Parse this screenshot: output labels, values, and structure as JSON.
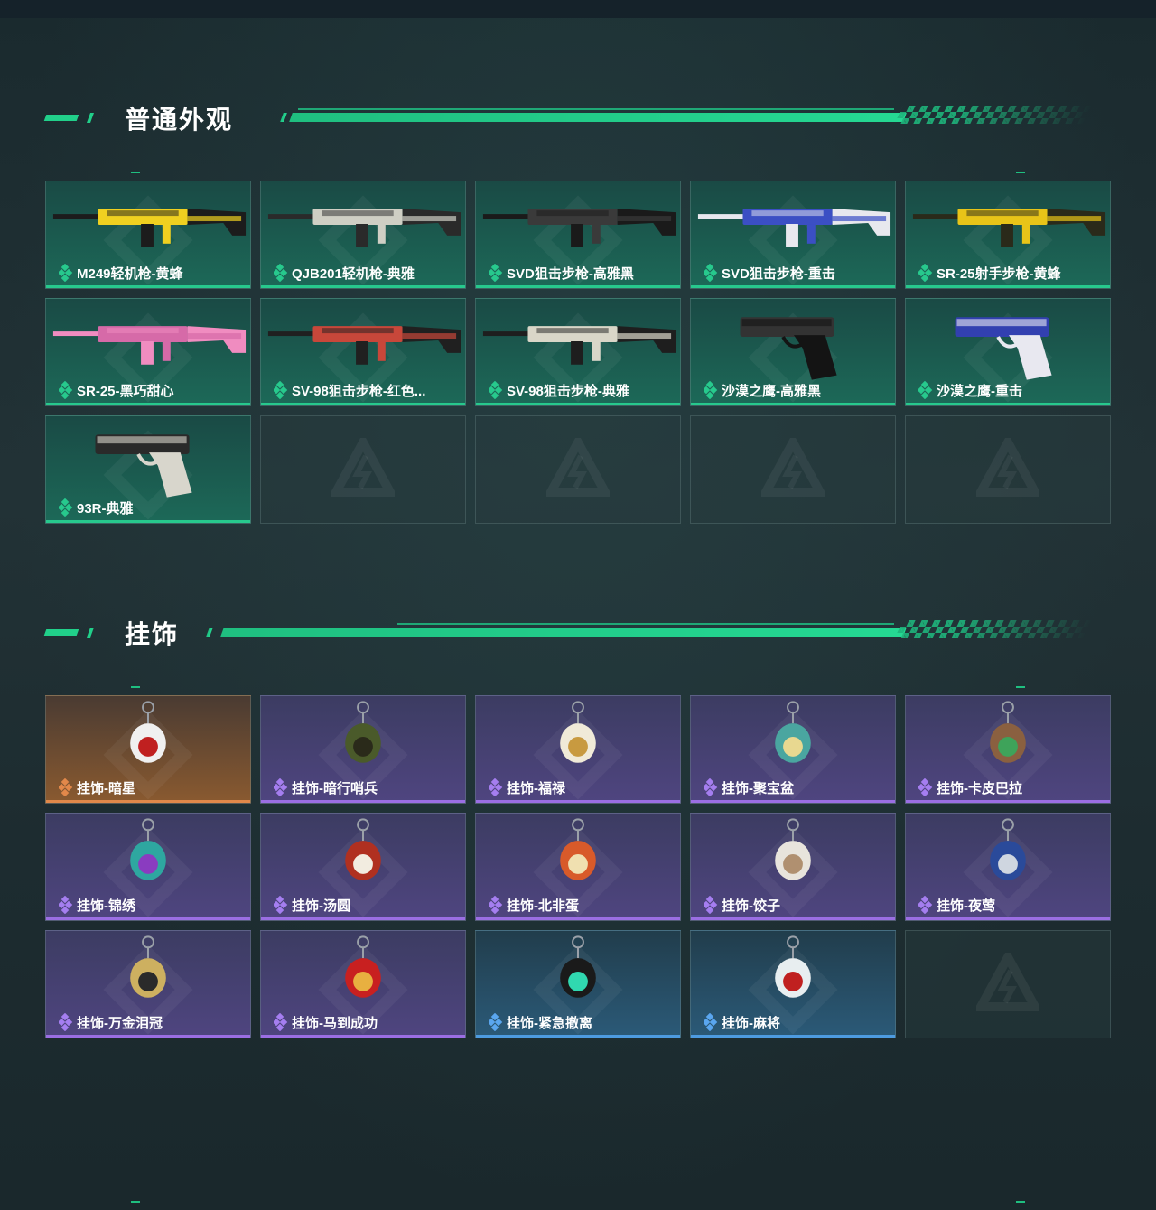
{
  "sections": [
    {
      "title": "普通外观",
      "items": [
        {
          "label": "M249轻机枪-黄蜂",
          "rarity": "green",
          "icon": "lmg-yellow-icon"
        },
        {
          "label": "QJB201轻机枪-典雅",
          "rarity": "green",
          "icon": "lmg-white-icon"
        },
        {
          "label": "SVD狙击步枪-高雅黑",
          "rarity": "green",
          "icon": "sniper-black-icon"
        },
        {
          "label": "SVD狙击步枪-重击",
          "rarity": "green",
          "icon": "sniper-blue-icon"
        },
        {
          "label": "SR-25射手步枪-黄蜂",
          "rarity": "green",
          "icon": "rifle-yellow-icon"
        },
        {
          "label": "SR-25-黑巧甜心",
          "rarity": "green",
          "icon": "rifle-pink-icon"
        },
        {
          "label": "SV-98狙击步枪-红色...",
          "rarity": "green",
          "icon": "sniper-red-icon"
        },
        {
          "label": "SV-98狙击步枪-典雅",
          "rarity": "green",
          "icon": "sniper-white-icon"
        },
        {
          "label": "沙漠之鹰-高雅黑",
          "rarity": "green",
          "icon": "pistol-black-icon"
        },
        {
          "label": "沙漠之鹰-重击",
          "rarity": "green",
          "icon": "pistol-blue-icon"
        },
        {
          "label": "93R-典雅",
          "rarity": "green",
          "icon": "pistol-camo-icon"
        }
      ]
    },
    {
      "title": "挂饰",
      "items": [
        {
          "label": "挂饰-暗星",
          "rarity": "orange",
          "icon": "charm-star-icon"
        },
        {
          "label": "挂饰-暗行哨兵",
          "rarity": "purple",
          "icon": "charm-sentinel-icon"
        },
        {
          "label": "挂饰-福禄",
          "rarity": "purple",
          "icon": "charm-gourd-icon"
        },
        {
          "label": "挂饰-聚宝盆",
          "rarity": "purple",
          "icon": "charm-bowl-icon"
        },
        {
          "label": "挂饰-卡皮巴拉",
          "rarity": "purple",
          "icon": "charm-capybara-icon"
        },
        {
          "label": "挂饰-锦绣",
          "rarity": "purple",
          "icon": "charm-butterfly-icon"
        },
        {
          "label": "挂饰-汤圆",
          "rarity": "purple",
          "icon": "charm-tangyuan-icon"
        },
        {
          "label": "挂饰-北非蛋",
          "rarity": "purple",
          "icon": "charm-shakshuka-icon"
        },
        {
          "label": "挂饰-饺子",
          "rarity": "purple",
          "icon": "charm-dumpling-icon"
        },
        {
          "label": "挂饰-夜莺",
          "rarity": "purple",
          "icon": "charm-feather-icon"
        },
        {
          "label": "挂饰-万金泪冠",
          "rarity": "purple",
          "icon": "charm-crown-icon"
        },
        {
          "label": "挂饰-马到成功",
          "rarity": "purple",
          "icon": "charm-horse-icon"
        },
        {
          "label": "挂饰-紧急撤离",
          "rarity": "blue",
          "icon": "charm-evac-icon"
        },
        {
          "label": "挂饰-麻将",
          "rarity": "blue",
          "icon": "charm-mahjong-icon"
        }
      ]
    }
  ]
}
